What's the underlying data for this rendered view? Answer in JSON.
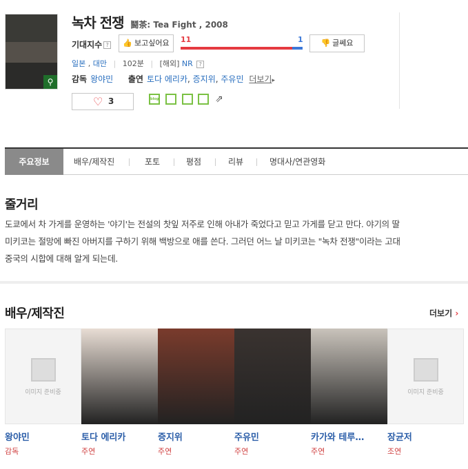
{
  "movie": {
    "title_ko": "녹차 전쟁",
    "title_en": "鬪茶: Tea Fight , 2008",
    "expect_label": "기대지수",
    "want_label": "보고싶어요",
    "no_label": "글쎄요",
    "want_count": "11",
    "no_count": "1",
    "want_ratio": 0.917,
    "countries": [
      "일본",
      "대만"
    ],
    "runtime": "102분",
    "rating_region": "[해외]",
    "rating": "NR",
    "director_label": "감독",
    "director": "왕야민",
    "cast_label": "출연",
    "cast_names": [
      "토다 에리카",
      "증지위",
      "주유민"
    ],
    "more_label": "더보기",
    "like_count": "3"
  },
  "icons": {
    "help": "?",
    "heart": "♡",
    "blog": "blog",
    "share": "share-icon"
  },
  "tabs": [
    "주요정보",
    "배우/제작진",
    "포토",
    "평점",
    "리뷰",
    "명대사/연관영화"
  ],
  "synopsis": {
    "title": "줄거리",
    "lines": [
      "도쿄에서 차 가게를 운영하는 '야기'는 전설의 찻잎 저주로 인해 아내가 죽었다고 믿고 가게를 닫고 만다. 야기의 딸",
      "미키코는 절망에 빠진 아버지를 구하기 위해 백방으로 애를 쓴다. 그러던 어느 날 미키코는 \"녹차 전쟁\"이라는 고대",
      "중국의 시합에 대해 알게 되는데."
    ]
  },
  "crew": {
    "title": "배우/제작진",
    "more_label": "더보기",
    "placeholder_text": "이미지 준비중",
    "people": [
      {
        "name": "왕야민",
        "role": "감독",
        "placeholder": true
      },
      {
        "name": "토다 에리카",
        "role": "주연",
        "placeholder": false,
        "tone": "#e8ddd4"
      },
      {
        "name": "증지위",
        "role": "주연",
        "placeholder": false,
        "tone": "#7a3b2c"
      },
      {
        "name": "주유민",
        "role": "주연",
        "placeholder": false,
        "tone": "#3a3330"
      },
      {
        "name": "카가와 테루…",
        "role": "주연",
        "placeholder": false,
        "tone": "#c9c3bb"
      },
      {
        "name": "장균저",
        "role": "조연",
        "placeholder": true
      }
    ]
  },
  "colors": {
    "accent_red": "#e53a40",
    "accent_blue": "#3b78d8",
    "link": "#2a6fbf",
    "green": "#7ac143"
  }
}
